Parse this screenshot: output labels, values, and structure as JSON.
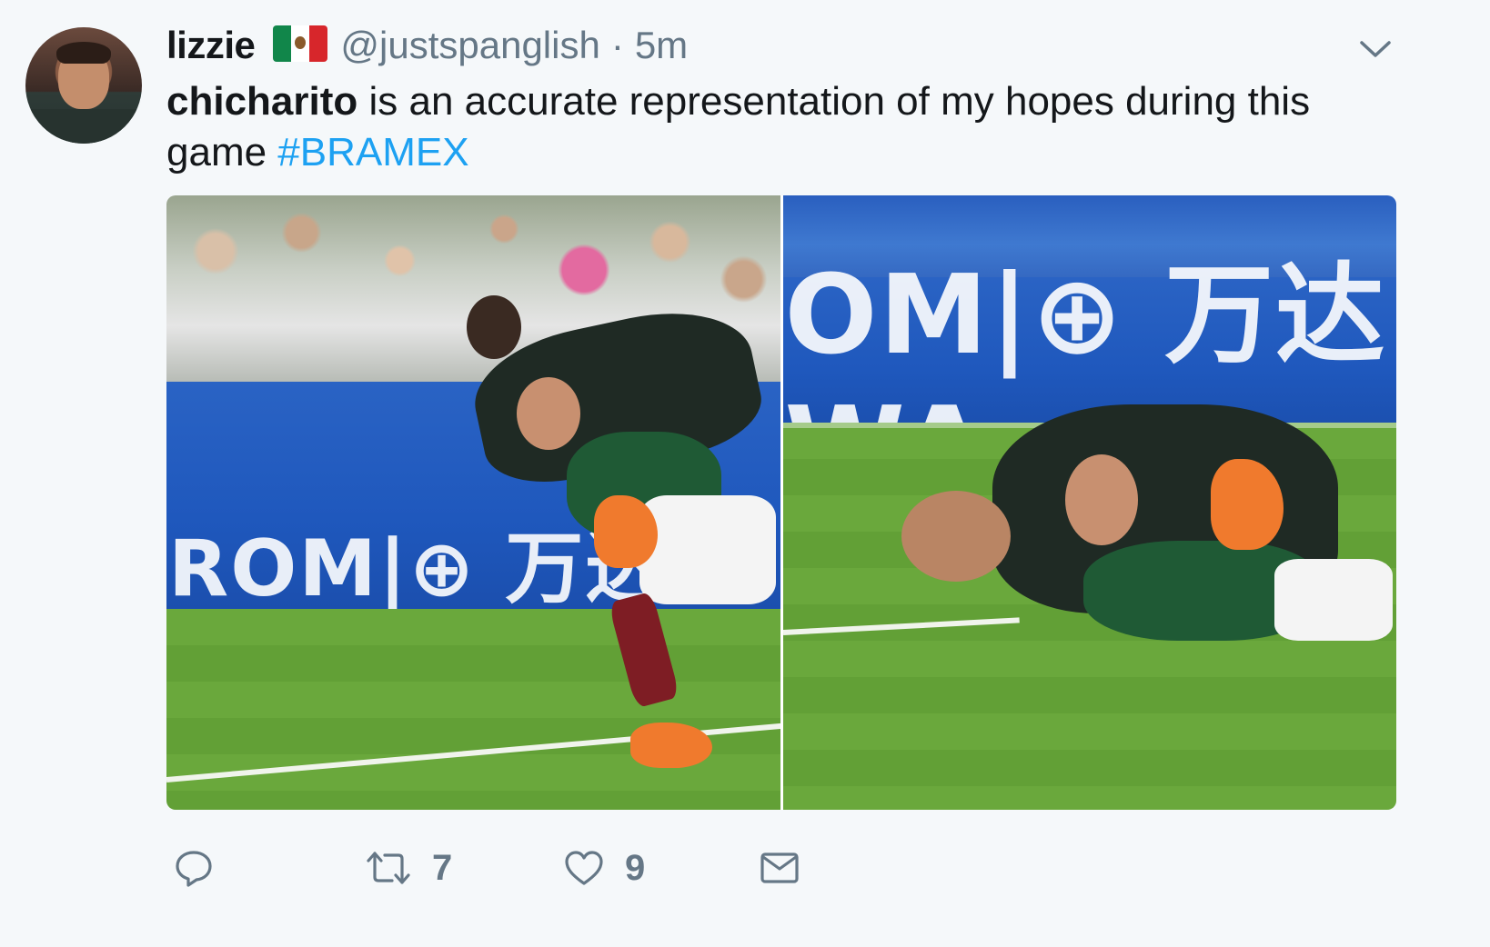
{
  "tweet": {
    "display_name": "lizzie",
    "handle": "@justspanglish",
    "separator": "·",
    "time": "5m",
    "text_bold": "chicharito",
    "text_rest": " is an accurate representation of my hopes during this game ",
    "hashtag": "#BRAMEX",
    "flag_icon": "mexico-flag-emoji",
    "menu_icon": "chevron-down-icon"
  },
  "media": {
    "photos": [
      {
        "banner_text": "ROM|⊕ 万达W"
      },
      {
        "banner_text": "OM|⊕ 万达WA"
      }
    ]
  },
  "actions": {
    "reply": {
      "icon": "reply-icon",
      "count": ""
    },
    "retweet": {
      "icon": "retweet-icon",
      "count": "7"
    },
    "like": {
      "icon": "heart-icon",
      "count": "9"
    },
    "message": {
      "icon": "envelope-icon",
      "count": ""
    }
  },
  "colors": {
    "background": "#f5f8fa",
    "text": "#14171a",
    "secondary": "#657786",
    "link": "#1da1f2"
  }
}
